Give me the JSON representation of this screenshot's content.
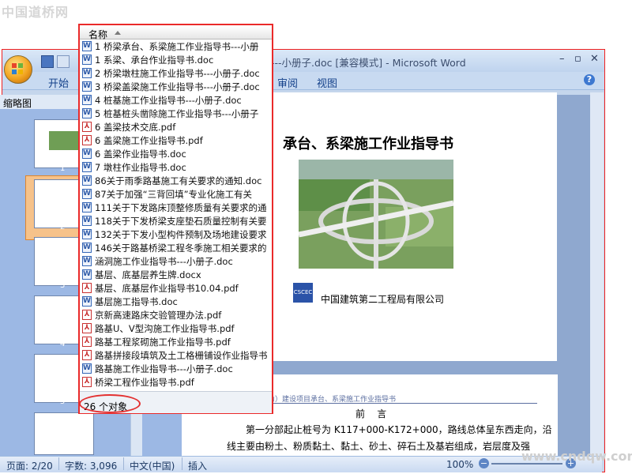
{
  "watermark_top": "中国道桥网",
  "watermark_bottom": "www.cndqw.com",
  "window": {
    "title": "---小册子.doc [兼容模式] - Microsoft Word",
    "tabs": [
      "开始",
      "审阅",
      "视图"
    ],
    "help": "?"
  },
  "nav_pane": {
    "title": "缩略图",
    "thumbnails": [
      "1",
      "2",
      "3",
      "4",
      "5"
    ]
  },
  "document": {
    "title": "承台、系梁施工作业指导书",
    "company": "中国建筑第二工程局有限公司",
    "logo_text": "CSCEC",
    "page2_header": "…河至白庄路段（河堤现为）建设项目承台、系梁施工作业指导书",
    "foreword": "前    言",
    "para_line1": "第一分部起止桩号为 K117+000-K172+000，路线总体呈东西走向，沿",
    "para_line2": "线主要由粉土、粉质黏土、黏土、砂土、碎石土及基岩组成，岩层度及强"
  },
  "statusbar": {
    "page": "页面: 2/20",
    "words": "字数: 3,096",
    "language": "中文(中国)",
    "insert": "插入",
    "zoom": "100%"
  },
  "explorer": {
    "column_header": "名称",
    "count": "26 个对象",
    "files": [
      {
        "name": "1 桥梁承台、系梁施工作业指导书---小册",
        "type": "doc"
      },
      {
        "name": "1 系梁、承台作业指导书.doc",
        "type": "doc"
      },
      {
        "name": "2 桥梁墩柱施工作业指导书---小册子.doc",
        "type": "doc"
      },
      {
        "name": "3 桥梁盖梁施工作业指导书---小册子.doc",
        "type": "doc"
      },
      {
        "name": "4 桩基施工作业指导书---小册子.doc",
        "type": "doc"
      },
      {
        "name": "5 桩基桩头凿除施工作业指导书---小册子",
        "type": "doc"
      },
      {
        "name": "6 盖梁技术交底.pdf",
        "type": "pdf"
      },
      {
        "name": "6 盖梁施工作业指导书.pdf",
        "type": "pdf"
      },
      {
        "name": "6 盖梁作业指导书.doc",
        "type": "doc"
      },
      {
        "name": "7 墩柱作业指导书.doc",
        "type": "doc"
      },
      {
        "name": "86关于雨季路基施工有关要求的通知.doc",
        "type": "doc"
      },
      {
        "name": "87关于加强“三背回填”专业化施工有关",
        "type": "doc"
      },
      {
        "name": "111关于下发路床顶整修质量有关要求的通",
        "type": "doc"
      },
      {
        "name": "118关于下发桥梁支座垫石质量控制有关要",
        "type": "doc"
      },
      {
        "name": "132关于下发小型构件预制及场地建设要求",
        "type": "doc"
      },
      {
        "name": "146关于路基桥梁工程冬季施工相关要求的",
        "type": "doc"
      },
      {
        "name": "涵洞施工作业指导书---小册子.doc",
        "type": "doc"
      },
      {
        "name": "基层、底基层养生牌.docx",
        "type": "doc"
      },
      {
        "name": "基层、底基层作业指导书10.04.pdf",
        "type": "pdf"
      },
      {
        "name": "基层施工指导书.doc",
        "type": "doc"
      },
      {
        "name": "京新高速路床交验管理办法.pdf",
        "type": "pdf"
      },
      {
        "name": "路基U、V型沟施工作业指导书.pdf",
        "type": "pdf"
      },
      {
        "name": "路基工程浆砌施工作业指导书.pdf",
        "type": "pdf"
      },
      {
        "name": "路基拼接段填筑及土工格栅铺设作业指导书",
        "type": "pdf"
      },
      {
        "name": "路基施工作业指导书---小册子.doc",
        "type": "doc"
      },
      {
        "name": "桥梁工程作业指导书.pdf",
        "type": "pdf"
      }
    ]
  }
}
